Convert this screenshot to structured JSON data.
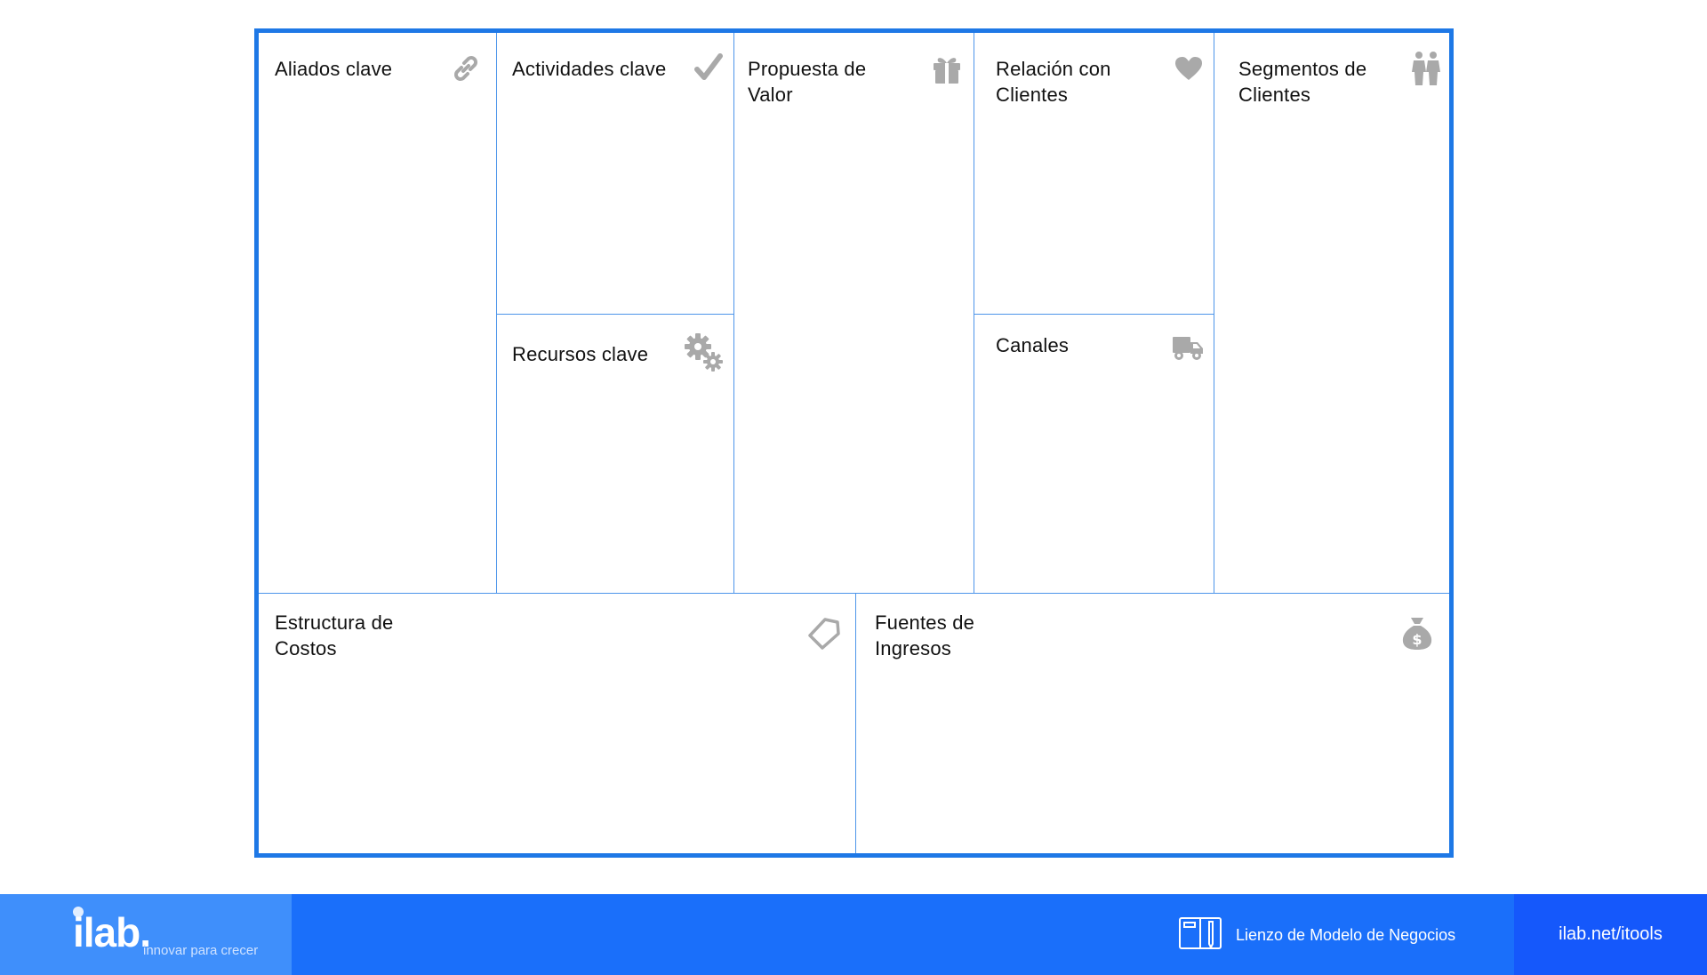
{
  "canvas": {
    "aliados": {
      "title_line1": "Aliados clave",
      "title_line2": "",
      "icon": "link-icon"
    },
    "actividades": {
      "title_line1": "Actividades clave",
      "title_line2": "",
      "icon": "checkmark-icon"
    },
    "recursos": {
      "title_line1": "Recursos clave",
      "title_line2": "",
      "icon": "gears-icon"
    },
    "propuesta": {
      "title_line1": "Propuesta de",
      "title_line2": "Valor",
      "icon": "gift-icon"
    },
    "relacion": {
      "title_line1": "Relación con",
      "title_line2": "Clientes",
      "icon": "heart-icon"
    },
    "canales": {
      "title_line1": "Canales",
      "title_line2": "",
      "icon": "truck-icon"
    },
    "segmentos": {
      "title_line1": "Segmentos de",
      "title_line2": "Clientes",
      "icon": "people-icon"
    },
    "costos": {
      "title_line1": "Estructura de",
      "title_line2": "Costos",
      "icon": "tag-icon"
    },
    "fuentes": {
      "title_line1": "Fuentes de",
      "title_line2": "Ingresos",
      "icon": "money-bag-icon"
    }
  },
  "colors": {
    "border": "#1e78e6",
    "divider": "#4d95ea",
    "icon": "#a9a9a9",
    "footer": "#1a6ffa",
    "footer_brand": "#3f8ffb",
    "footer_site": "#1558fb"
  },
  "footer": {
    "logo": "ilab.",
    "tagline": "innovar para crecer",
    "product_name": "Lienzo de Modelo de Negocios",
    "product_icon": "notebook-pencil-icon",
    "site": "ilab.net/itools"
  }
}
